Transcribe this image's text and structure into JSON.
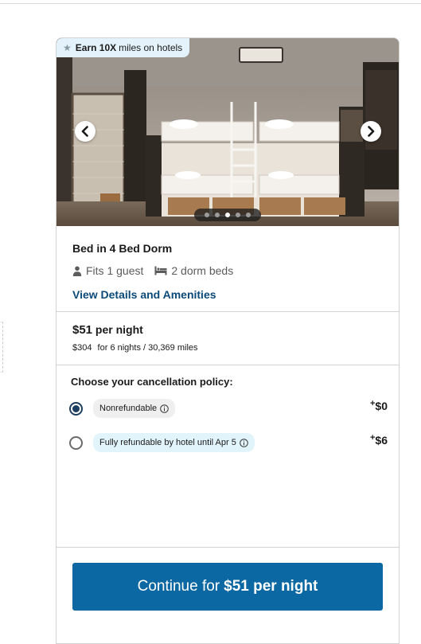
{
  "promo": {
    "bold": "Earn 10X",
    "text": "miles on hotels",
    "icon": "star-icon"
  },
  "gallery": {
    "photo_count": 5,
    "active_photo": 3
  },
  "room": {
    "title": "Bed in 4 Bed Dorm",
    "guests": "Fits 1 guest",
    "beds": "2 dorm beds",
    "details_link": "View Details and Amenities"
  },
  "pricing": {
    "nightly_amount": "$51",
    "nightly_unit": "per night",
    "total_amount": "$304",
    "total_detail": "for 6 nights / 30,369 miles"
  },
  "cancellation": {
    "title": "Choose your cancellation policy:",
    "options": [
      {
        "label": "Nonrefundable",
        "plus": "+",
        "price": "$0",
        "selected": true
      },
      {
        "label": "Fully refundable by hotel until Apr 5",
        "plus": "+",
        "price": "$6",
        "selected": false
      }
    ]
  },
  "cta": {
    "prefix": "Continue for",
    "strong": "$51 per night"
  },
  "colors": {
    "accent": "#0b68a3",
    "link": "#0b4a78",
    "promo_bg": "#e4f3fb",
    "radio_selected": "#1c3f5f"
  }
}
